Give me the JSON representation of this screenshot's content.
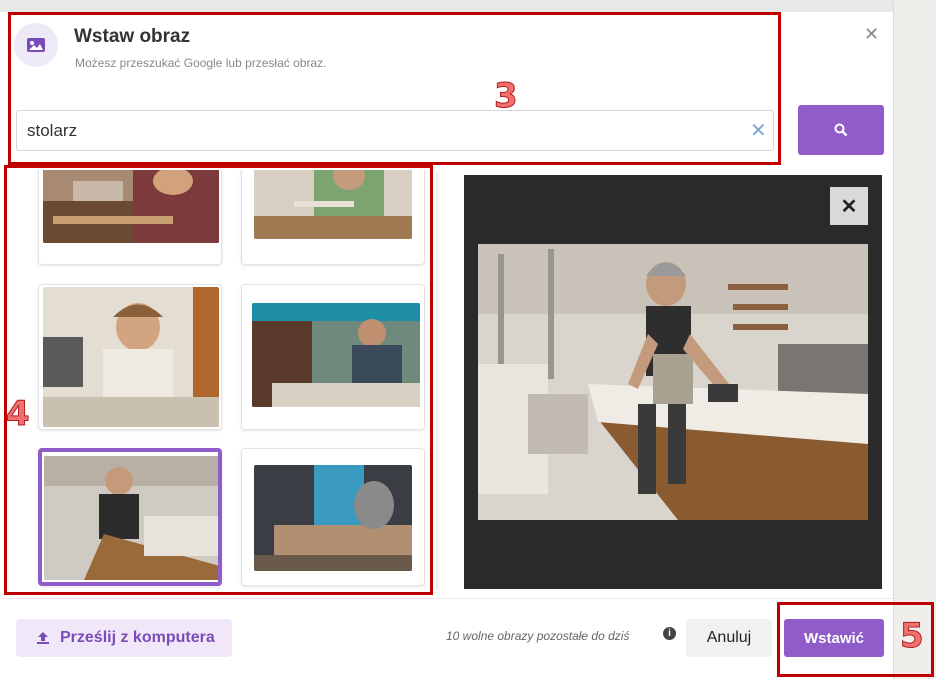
{
  "dialog": {
    "title": "Wstaw obraz",
    "subtitle": "Możesz przeszukać Google lub przesłać obraz."
  },
  "search": {
    "value": "stolarz"
  },
  "icons": {
    "header": "image-icon",
    "close": "close-icon",
    "clear": "clear-icon",
    "search": "search-icon",
    "upload": "upload-icon",
    "info": "info-icon"
  },
  "results": {
    "selected_index": 4,
    "count_visible": 6
  },
  "footer": {
    "upload_label": "Prześlij z komputera",
    "quota_text": "10 wolne obrazy pozostałe do dziś",
    "cancel_label": "Anuluj",
    "insert_label": "Wstawić"
  },
  "annotations": [
    "3",
    "4",
    "5"
  ],
  "colors": {
    "accent": "#8f5cc9",
    "annotation": "#c00000",
    "preview_bg": "#2a2a2a"
  }
}
